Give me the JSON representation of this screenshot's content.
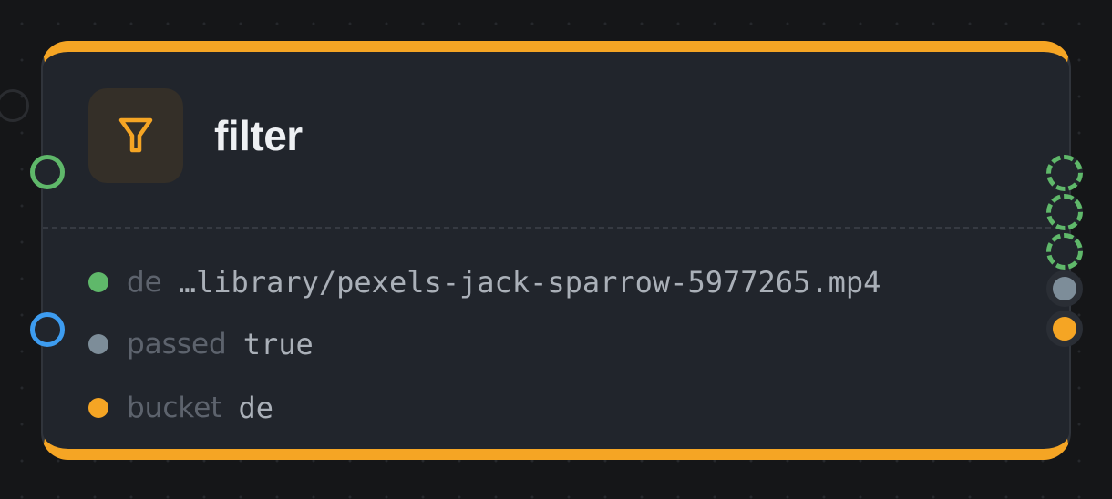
{
  "node": {
    "title": "filter",
    "icon": "filter-funnel-icon",
    "accent_color": "#f5a524",
    "fields": [
      {
        "label": "de",
        "value": "…library/pexels-jack-sparrow-5977265.mp4",
        "dot_color": "#5fb86a"
      },
      {
        "label": "passed",
        "value": "true",
        "dot_color": "#7d8d99"
      },
      {
        "label": "bucket",
        "value": "de",
        "dot_color": "#f5a524"
      }
    ]
  },
  "ports": {
    "inputs": [
      {
        "name": "data-in",
        "color": "#5fb86a"
      },
      {
        "name": "control-in",
        "color": "#3d9cf0"
      }
    ],
    "outputs": [
      {
        "name": "out-1",
        "color": "#5fb86a",
        "style": "dashed"
      },
      {
        "name": "out-2",
        "color": "#5fb86a",
        "style": "dashed"
      },
      {
        "name": "out-3",
        "color": "#5fb86a",
        "style": "dashed"
      },
      {
        "name": "passed-out",
        "color": "#7d8d99",
        "style": "filled"
      },
      {
        "name": "bucket-out",
        "color": "#f5a524",
        "style": "filled"
      }
    ]
  }
}
